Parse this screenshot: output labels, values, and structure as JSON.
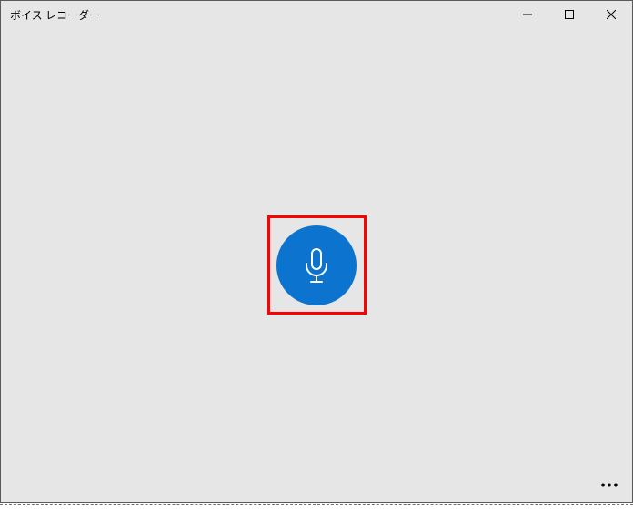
{
  "app": {
    "title": "ボイス レコーダー"
  },
  "controls": {
    "record_label": "録音",
    "more_label": "その他"
  },
  "colors": {
    "accent": "#0c74ce",
    "highlight": "#ff0000",
    "background": "#e6e6e6"
  },
  "icons": {
    "minimize": "minimize-icon",
    "maximize": "maximize-icon",
    "close": "close-icon",
    "microphone": "microphone-icon",
    "more": "more-icon"
  }
}
